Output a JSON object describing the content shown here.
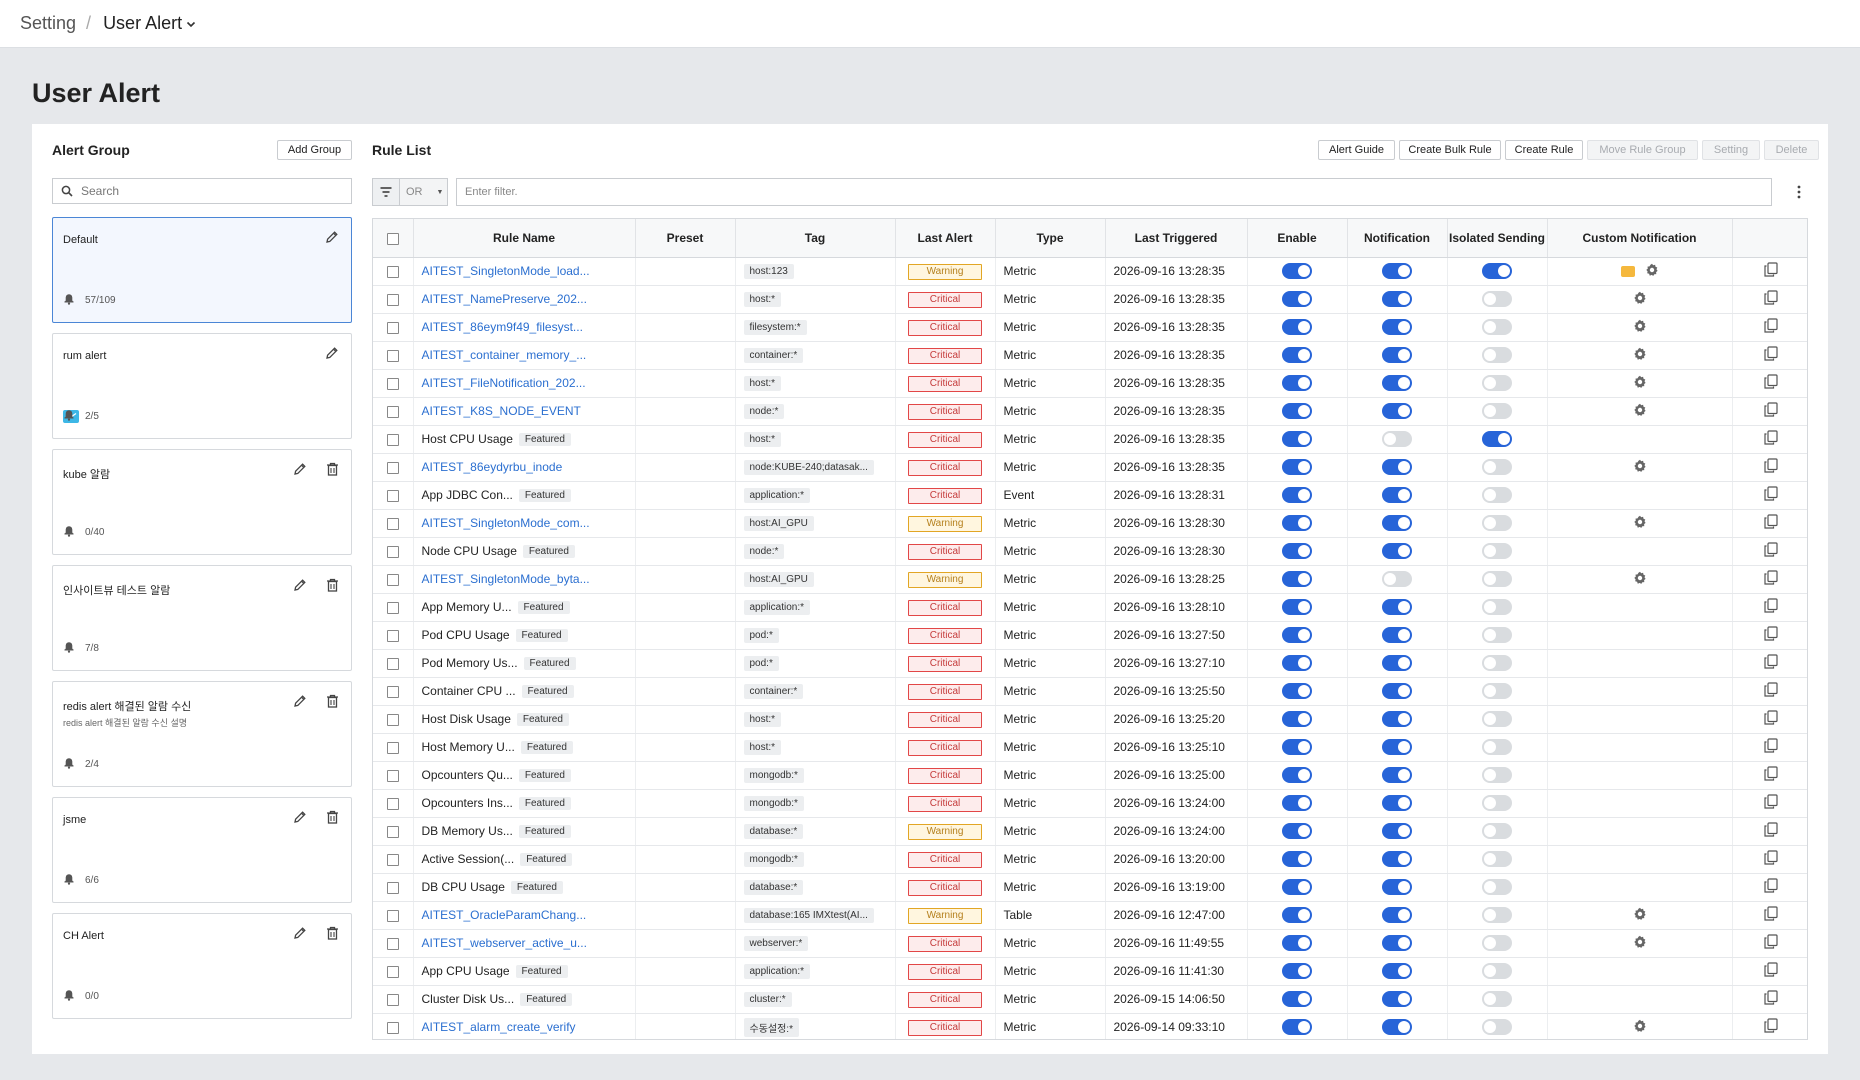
{
  "breadcrumb": {
    "parent": "Setting",
    "separator": "/",
    "current": "User Alert"
  },
  "page_title": "User Alert",
  "alert_group": {
    "title": "Alert Group",
    "add_button": "Add Group",
    "search_placeholder": "Search",
    "groups": [
      {
        "name": "Default",
        "description": "",
        "count": "57/109",
        "selected": true,
        "deletable": false,
        "has_mail": false
      },
      {
        "name": "rum alert",
        "description": "",
        "count": "2/5",
        "selected": false,
        "deletable": false,
        "has_mail": true
      },
      {
        "name": "kube 알람",
        "description": "",
        "count": "0/40",
        "selected": false,
        "deletable": true,
        "has_mail": false
      },
      {
        "name": "인사이트뷰 테스트 알람",
        "description": "",
        "count": "7/8",
        "selected": false,
        "deletable": true,
        "has_mail": false
      },
      {
        "name": "redis alert 해결된 알람 수신",
        "description": "redis alert 해결된 알람 수신 설명",
        "count": "2/4",
        "selected": false,
        "deletable": true,
        "has_mail": false
      },
      {
        "name": "jsme",
        "description": "",
        "count": "6/6",
        "selected": false,
        "deletable": true,
        "has_mail": false
      },
      {
        "name": "CH Alert",
        "description": "",
        "count": "0/0",
        "selected": false,
        "deletable": true,
        "has_mail": false
      }
    ]
  },
  "rule_list": {
    "title": "Rule List",
    "buttons": {
      "alert_guide": "Alert Guide",
      "create_bulk_rule": "Create Bulk Rule",
      "create_rule": "Create Rule",
      "move_rule_group": "Move Rule Group",
      "setting": "Setting",
      "delete": "Delete"
    },
    "filter": {
      "operator": "OR",
      "placeholder": "Enter filter."
    },
    "columns": {
      "rule_name": "Rule Name",
      "preset": "Preset",
      "tag": "Tag",
      "last_alert": "Last Alert",
      "type": "Type",
      "last_triggered": "Last Triggered",
      "enable": "Enable",
      "notification": "Notification",
      "isolated_sending": "Isolated Sending",
      "custom_notification": "Custom Notification"
    },
    "featured_label": "Featured",
    "rows": [
      {
        "name": "AITEST_SingletonMode_load...",
        "link": true,
        "featured": false,
        "tag": "host:123",
        "alert": "Warning",
        "type": "Metric",
        "triggered": "2026-09-16 13:28:35",
        "enable": true,
        "notification": true,
        "isolated": true,
        "custom": "badge-gear"
      },
      {
        "name": "AITEST_NamePreserve_202...",
        "link": true,
        "featured": false,
        "tag": "host:*",
        "alert": "Critical",
        "type": "Metric",
        "triggered": "2026-09-16 13:28:35",
        "enable": true,
        "notification": true,
        "isolated": false,
        "custom": "gear"
      },
      {
        "name": "AITEST_86eym9f49_filesyst...",
        "link": true,
        "featured": false,
        "tag": "filesystem:*",
        "alert": "Critical",
        "type": "Metric",
        "triggered": "2026-09-16 13:28:35",
        "enable": true,
        "notification": true,
        "isolated": false,
        "custom": "gear"
      },
      {
        "name": "AITEST_container_memory_...",
        "link": true,
        "featured": false,
        "tag": "container:*",
        "alert": "Critical",
        "type": "Metric",
        "triggered": "2026-09-16 13:28:35",
        "enable": true,
        "notification": true,
        "isolated": false,
        "custom": "gear"
      },
      {
        "name": "AITEST_FileNotification_202...",
        "link": true,
        "featured": false,
        "tag": "host:*",
        "alert": "Critical",
        "type": "Metric",
        "triggered": "2026-09-16 13:28:35",
        "enable": true,
        "notification": true,
        "isolated": false,
        "custom": "gear"
      },
      {
        "name": "AITEST_K8S_NODE_EVENT",
        "link": true,
        "featured": false,
        "tag": "node:*",
        "alert": "Critical",
        "type": "Metric",
        "triggered": "2026-09-16 13:28:35",
        "enable": true,
        "notification": true,
        "isolated": false,
        "custom": "gear"
      },
      {
        "name": "Host CPU Usage",
        "link": false,
        "featured": true,
        "tag": "host:*",
        "alert": "Critical",
        "type": "Metric",
        "triggered": "2026-09-16 13:28:35",
        "enable": true,
        "notification": false,
        "isolated": true,
        "custom": "none"
      },
      {
        "name": "AITEST_86eydyrbu_inode",
        "link": true,
        "featured": false,
        "tag": "node:KUBE-240;datasak...",
        "alert": "Critical",
        "type": "Metric",
        "triggered": "2026-09-16 13:28:35",
        "enable": true,
        "notification": true,
        "isolated": false,
        "custom": "gear"
      },
      {
        "name": "App JDBC Con...",
        "link": false,
        "featured": true,
        "tag": "application:*",
        "alert": "Critical",
        "type": "Event",
        "triggered": "2026-09-16 13:28:31",
        "enable": true,
        "notification": true,
        "isolated": false,
        "custom": "none"
      },
      {
        "name": "AITEST_SingletonMode_com...",
        "link": true,
        "featured": false,
        "tag": "host:AI_GPU",
        "alert": "Warning",
        "type": "Metric",
        "triggered": "2026-09-16 13:28:30",
        "enable": true,
        "notification": true,
        "isolated": false,
        "custom": "gear"
      },
      {
        "name": "Node CPU Usage",
        "link": false,
        "featured": true,
        "tag": "node:*",
        "alert": "Critical",
        "type": "Metric",
        "triggered": "2026-09-16 13:28:30",
        "enable": true,
        "notification": true,
        "isolated": false,
        "custom": "none"
      },
      {
        "name": "AITEST_SingletonMode_byta...",
        "link": true,
        "featured": false,
        "tag": "host:AI_GPU",
        "alert": "Warning",
        "type": "Metric",
        "triggered": "2026-09-16 13:28:25",
        "enable": true,
        "notification": false,
        "isolated": false,
        "custom": "gear"
      },
      {
        "name": "App Memory U...",
        "link": false,
        "featured": true,
        "tag": "application:*",
        "alert": "Critical",
        "type": "Metric",
        "triggered": "2026-09-16 13:28:10",
        "enable": true,
        "notification": true,
        "isolated": false,
        "custom": "none"
      },
      {
        "name": "Pod CPU Usage",
        "link": false,
        "featured": true,
        "tag": "pod:*",
        "alert": "Critical",
        "type": "Metric",
        "triggered": "2026-09-16 13:27:50",
        "enable": true,
        "notification": true,
        "isolated": false,
        "custom": "none"
      },
      {
        "name": "Pod Memory Us...",
        "link": false,
        "featured": true,
        "tag": "pod:*",
        "alert": "Critical",
        "type": "Metric",
        "triggered": "2026-09-16 13:27:10",
        "enable": true,
        "notification": true,
        "isolated": false,
        "custom": "none"
      },
      {
        "name": "Container CPU ...",
        "link": false,
        "featured": true,
        "tag": "container:*",
        "alert": "Critical",
        "type": "Metric",
        "triggered": "2026-09-16 13:25:50",
        "enable": true,
        "notification": true,
        "isolated": false,
        "custom": "none"
      },
      {
        "name": "Host Disk Usage",
        "link": false,
        "featured": true,
        "tag": "host:*",
        "alert": "Critical",
        "type": "Metric",
        "triggered": "2026-09-16 13:25:20",
        "enable": true,
        "notification": true,
        "isolated": false,
        "custom": "none"
      },
      {
        "name": "Host Memory U...",
        "link": false,
        "featured": true,
        "tag": "host:*",
        "alert": "Critical",
        "type": "Metric",
        "triggered": "2026-09-16 13:25:10",
        "enable": true,
        "notification": true,
        "isolated": false,
        "custom": "none"
      },
      {
        "name": "Opcounters Qu...",
        "link": false,
        "featured": true,
        "tag": "mongodb:*",
        "alert": "Critical",
        "type": "Metric",
        "triggered": "2026-09-16 13:25:00",
        "enable": true,
        "notification": true,
        "isolated": false,
        "custom": "none"
      },
      {
        "name": "Opcounters Ins...",
        "link": false,
        "featured": true,
        "tag": "mongodb:*",
        "alert": "Critical",
        "type": "Metric",
        "triggered": "2026-09-16 13:24:00",
        "enable": true,
        "notification": true,
        "isolated": false,
        "custom": "none"
      },
      {
        "name": "DB Memory Us...",
        "link": false,
        "featured": true,
        "tag": "database:*",
        "alert": "Warning",
        "type": "Metric",
        "triggered": "2026-09-16 13:24:00",
        "enable": true,
        "notification": true,
        "isolated": false,
        "custom": "none"
      },
      {
        "name": "Active Session(...",
        "link": false,
        "featured": true,
        "tag": "mongodb:*",
        "alert": "Critical",
        "type": "Metric",
        "triggered": "2026-09-16 13:20:00",
        "enable": true,
        "notification": true,
        "isolated": false,
        "custom": "none"
      },
      {
        "name": "DB CPU Usage",
        "link": false,
        "featured": true,
        "tag": "database:*",
        "alert": "Critical",
        "type": "Metric",
        "triggered": "2026-09-16 13:19:00",
        "enable": true,
        "notification": true,
        "isolated": false,
        "custom": "none"
      },
      {
        "name": "AITEST_OracleParamChang...",
        "link": true,
        "featured": false,
        "tag": "database:165 IMXtest(AI...",
        "alert": "Warning",
        "type": "Table",
        "triggered": "2026-09-16 12:47:00",
        "enable": true,
        "notification": true,
        "isolated": false,
        "custom": "gear"
      },
      {
        "name": "AITEST_webserver_active_u...",
        "link": true,
        "featured": false,
        "tag": "webserver:*",
        "alert": "Critical",
        "type": "Metric",
        "triggered": "2026-09-16 11:49:55",
        "enable": true,
        "notification": true,
        "isolated": false,
        "custom": "gear"
      },
      {
        "name": "App CPU Usage",
        "link": false,
        "featured": true,
        "tag": "application:*",
        "alert": "Critical",
        "type": "Metric",
        "triggered": "2026-09-16 11:41:30",
        "enable": true,
        "notification": true,
        "isolated": false,
        "custom": "none"
      },
      {
        "name": "Cluster Disk Us...",
        "link": false,
        "featured": true,
        "tag": "cluster:*",
        "alert": "Critical",
        "type": "Metric",
        "triggered": "2026-09-15 14:06:50",
        "enable": true,
        "notification": true,
        "isolated": false,
        "custom": "none"
      },
      {
        "name": "AITEST_alarm_create_verify",
        "link": true,
        "featured": false,
        "tag": "수동설정:*",
        "alert": "Critical",
        "type": "Metric",
        "triggered": "2026-09-14 09:33:10",
        "enable": true,
        "notification": true,
        "isolated": false,
        "custom": "gear"
      }
    ]
  },
  "colors": {
    "accent": "#2764d8",
    "link": "#2b6fd0",
    "critical": "#e24747",
    "warning": "#e2a624",
    "background": "#e6e8eb"
  }
}
